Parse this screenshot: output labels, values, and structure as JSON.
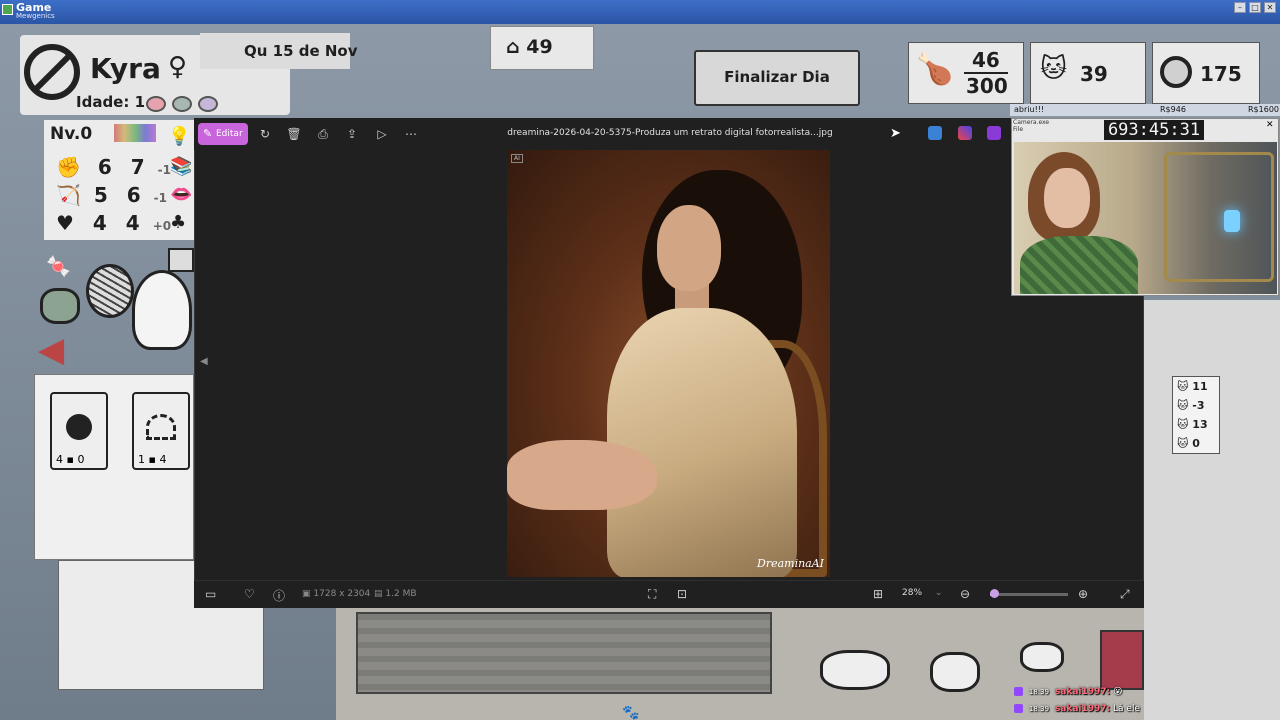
{
  "window": {
    "title": "Game",
    "subtitle": "Mewgenics"
  },
  "game": {
    "cat_name": "Kyra",
    "female_symbol": "♀",
    "age_label": "Idade: 1",
    "date": "Qu 15 de Nov",
    "house_count": "49",
    "finalizar_label": "Finalizar Dia",
    "food_current": "46",
    "food_max": "300",
    "cats_count": "39",
    "coins": "175",
    "level": "Nv.0",
    "stats": [
      {
        "a": "6",
        "b": "7",
        "mod": "-1"
      },
      {
        "a": "5",
        "b": "6",
        "mod": "-1"
      },
      {
        "a": "4",
        "b": "4",
        "mod": "+0"
      }
    ],
    "card1_count": "4",
    "card2_count": "1",
    "card1_count_b": "0",
    "card2_count_b": "4",
    "side_counts": [
      "11",
      "-3",
      "13",
      "0"
    ]
  },
  "viewer": {
    "edit_label": "Editar",
    "filename": "dreamina-2026-04-20-5375-Produza um retrato digital fotorrealista...jpg",
    "ai_badge": "AI",
    "watermark": "DreaminaAI",
    "dimensions": "1728 x 2304",
    "filesize": "1.2 MB",
    "zoom": "28%",
    "zoom_fraction": 0.05
  },
  "webcam": {
    "label_left": "abriu!!!",
    "label_mid": "R$946",
    "label_right": "R$1600",
    "window_title": "Camera.exe",
    "window_sub": "File",
    "timer": "693:45:31"
  },
  "chat": [
    {
      "time": "18:39",
      "user": "sakai1997:",
      "msg": "😮"
    },
    {
      "time": "18:39",
      "user": "sakai1997:",
      "msg": "Lá ele"
    }
  ]
}
